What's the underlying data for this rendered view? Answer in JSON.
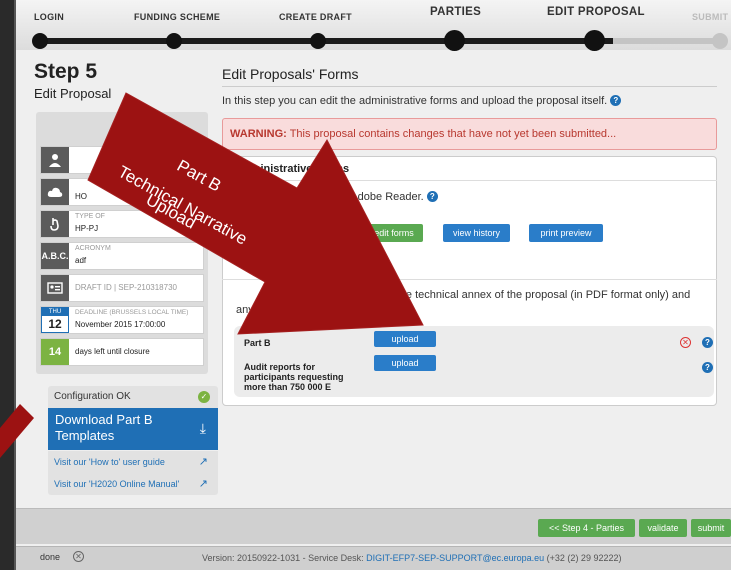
{
  "wizard": {
    "steps": [
      {
        "label": "LOGIN"
      },
      {
        "label": "FUNDING SCHEME"
      },
      {
        "label": "CREATE DRAFT"
      },
      {
        "label": "PARTIES"
      },
      {
        "label": "EDIT PROPOSAL"
      },
      {
        "label": "SUBMIT"
      }
    ]
  },
  "left": {
    "step_title": "Step 5",
    "step_subtitle": "Edit Proposal",
    "panel_header": "5",
    "fragment_ho": "HO",
    "type_label": "TYPE OF",
    "type_value": "HP-PJ",
    "acronym_label": "ACRONYM",
    "acronym_value": "adf",
    "acronym_icon": "A.B.C.",
    "draft_id": "DRAFT ID | SEP-210318730",
    "deadline_dow": "THU",
    "deadline_day": "12",
    "deadline_label": "DEADLINE (Brussels Local Time)",
    "deadline_value": "November 2015 17:00:00",
    "days_left_count": "14",
    "days_left_text": "days left until closure",
    "config_status": "Configuration OK",
    "download_templates": "Download Part B Templates",
    "howto_link": "Visit our 'How to' user guide",
    "manual_link": "Visit our 'H2020 Online Manual'"
  },
  "main": {
    "title": "Edit Proposals' Forms",
    "intro": "In this step you can edit the administrative forms and upload the proposal itself.",
    "warning_label": "WARNING:",
    "warning_text": "This proposal contains changes that have not yet been submitted...",
    "admin_title": "Administrative Forms",
    "admin_text": "it will open the forms in Adobe Reader.",
    "btn_edit_forms": "edit forms",
    "btn_view_history": "view history",
    "btn_print_preview": "print preview",
    "upload_title_fragment": "s",
    "upload_text_line1": "ny upload the technical annex of the proposal (in PDF format only) and",
    "upload_text_line2_a": "any",
    "upload_text_line2_b": "ttachments.",
    "uploads": [
      {
        "label": "Part B",
        "button": "upload"
      },
      {
        "label": "Audit reports for participants requesting more than 750 000 E",
        "button": "upload"
      }
    ]
  },
  "actions": {
    "back": "<< Step 4 - Parties",
    "validate": "validate",
    "submit": "submit"
  },
  "status": {
    "done": "done",
    "version_prefix": "Version: 20150922-1031 - Service Desk:",
    "service_link": "DIGIT-EFP7-SEP-SUPPORT@ec.europa.eu",
    "phone": "(+32 (2) 29 92222)"
  },
  "overlay": {
    "line1": "Part B",
    "line2": "Upload",
    "line3": "Technical Narrative"
  },
  "colors": {
    "accent_blue": "#1f6fb5",
    "success_green": "#5aa951",
    "arrow_red": "#9c1212",
    "warning_bg": "#f9dcdc",
    "warning_text": "#b8382f"
  }
}
